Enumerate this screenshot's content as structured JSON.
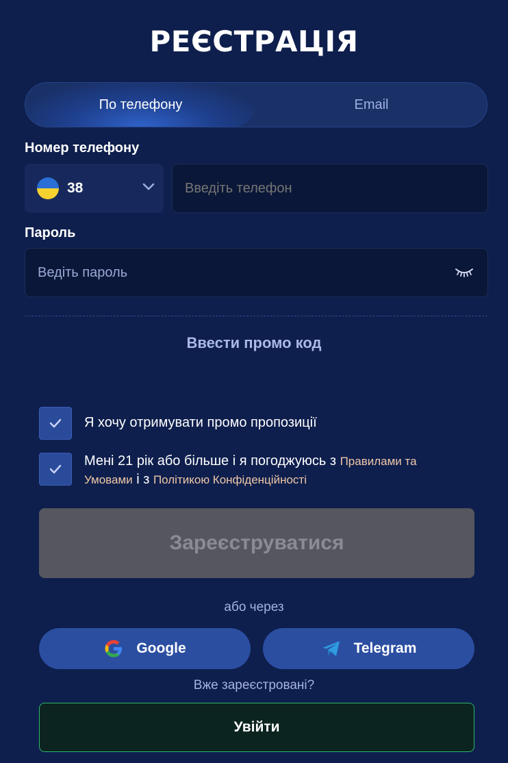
{
  "title": "РЕЄСТРАЦІЯ",
  "tabs": [
    {
      "label": "По телефону",
      "active": true
    },
    {
      "label": "Email",
      "active": false
    }
  ],
  "phone": {
    "label": "Номер телефону",
    "country_code": "38",
    "flag": "ukraine-flag",
    "placeholder": "Введіть телефон"
  },
  "password": {
    "label": "Пароль",
    "placeholder": "Ведіть пароль",
    "toggle_icon": "eye-closed-icon"
  },
  "promo_label": "Ввести промо код",
  "checkboxes": {
    "promo": {
      "text": "Я хочу отримувати промо пропозиції",
      "checked": true
    },
    "terms": {
      "text_1": "Мені 21 рік або більше і я погоджуюсь з",
      "link_1": "Правилами та Умовами",
      "text_2": "і з",
      "link_2": "Політикою Конфіденційності",
      "checked": true
    }
  },
  "register_button": "Зареєструватися",
  "or_text": "або через",
  "social": {
    "google": "Google",
    "telegram": "Telegram"
  },
  "already_text": "Вже зареєстровані?",
  "login_button": "Увійти",
  "colors": {
    "background": "#0e1f4d",
    "accent": "#2b4ea1",
    "login_border": "#2fb56a",
    "link": "#f0c8a8"
  }
}
